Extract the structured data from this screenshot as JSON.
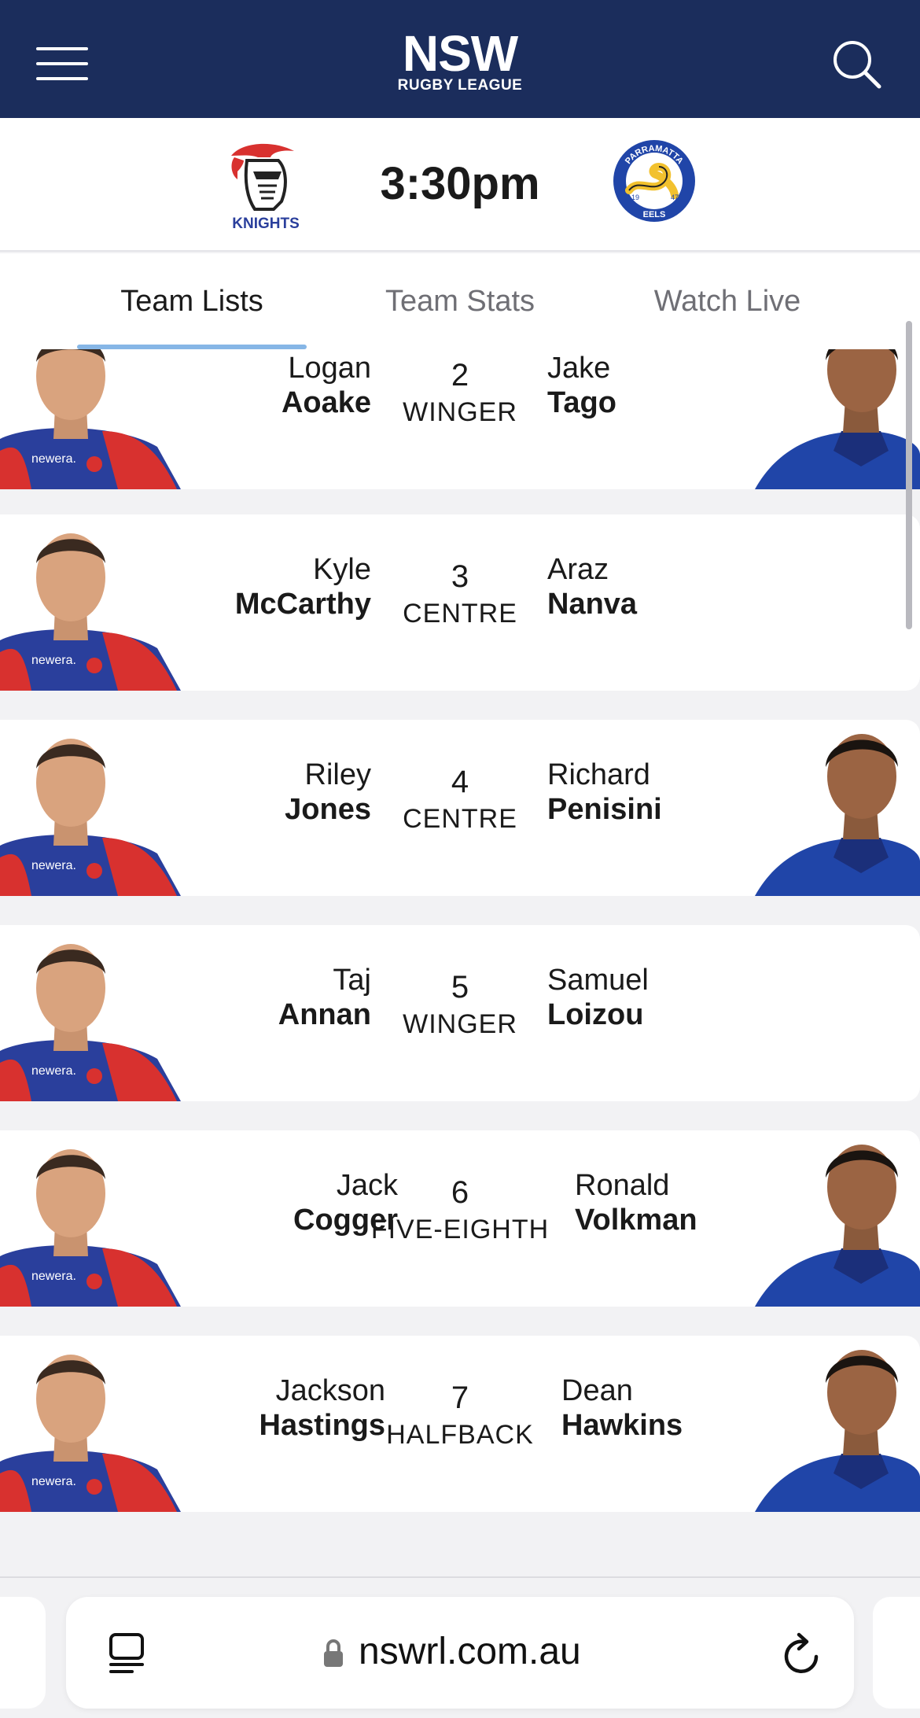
{
  "header": {
    "logo_main": "NSW",
    "logo_sub": "RUGBY LEAGUE",
    "bg_color": "#1b2d5c"
  },
  "match": {
    "home_team": "KNIGHTS",
    "kickoff": "3:30pm",
    "away_badge_top": "PARRAMATTA",
    "away_badge_bottom": "EELS",
    "away_badge_year_left": "19",
    "away_badge_year_right": "47"
  },
  "tabs": [
    {
      "label": "Team Lists",
      "active": true
    },
    {
      "label": "Team Stats",
      "active": false
    },
    {
      "label": "Watch Live",
      "active": false
    }
  ],
  "players": [
    {
      "home_first": "Logan",
      "home_last": "Aoake",
      "number": "2",
      "position": "WINGER",
      "away_first": "Jake",
      "away_last": "Tago",
      "away_photo": true
    },
    {
      "home_first": "Kyle",
      "home_last": "McCarthy",
      "number": "3",
      "position": "CENTRE",
      "away_first": "Araz",
      "away_last": "Nanva",
      "away_photo": false
    },
    {
      "home_first": "Riley",
      "home_last": "Jones",
      "number": "4",
      "position": "CENTRE",
      "away_first": "Richard",
      "away_last": "Penisini",
      "away_photo": true
    },
    {
      "home_first": "Taj",
      "home_last": "Annan",
      "number": "5",
      "position": "WINGER",
      "away_first": "Samuel",
      "away_last": "Loizou",
      "away_photo": false
    },
    {
      "home_first": "Jack",
      "home_last": "Cogger",
      "number": "6",
      "position": "FIVE-EIGHTH",
      "away_first": "Ronald",
      "away_last": "Volkman",
      "away_photo": true
    },
    {
      "home_first": "Jackson",
      "home_last": "Hastings",
      "number": "7",
      "position": "HALFBACK",
      "away_first": "Dean",
      "away_last": "Hawkins",
      "away_photo": true
    }
  ],
  "jersey_text": "newera.",
  "browser": {
    "url": "nswrl.com.au",
    "tabs_icon": "tabs-overview-icon",
    "lock_icon": "lock-icon",
    "reload_icon": "reload-icon"
  },
  "colors": {
    "knights_red": "#d8312f",
    "knights_blue": "#2a3f9c",
    "eels_blue": "#2045a8",
    "eels_gold": "#f2c12e",
    "tab_underline": "#86b6e6"
  }
}
